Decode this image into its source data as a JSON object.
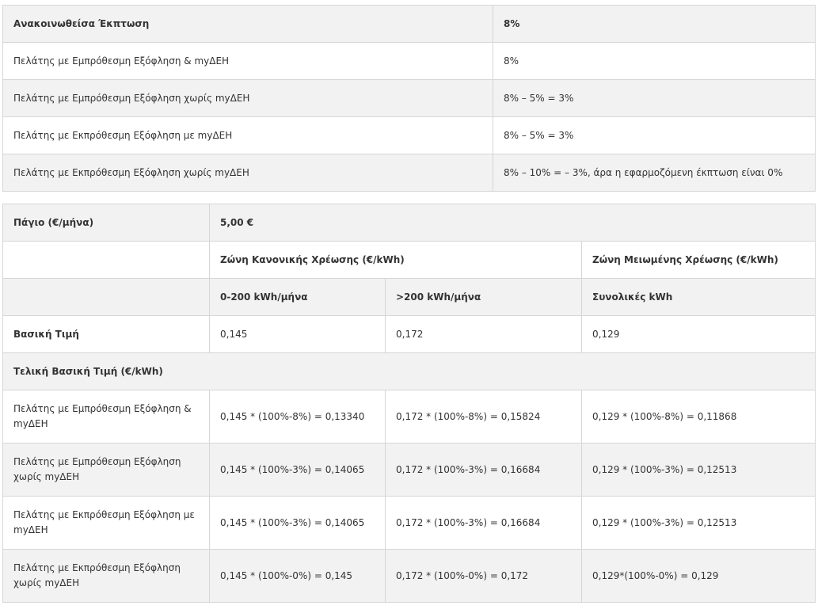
{
  "discount_table": {
    "header": {
      "label": "Ανακοινωθείσα Έκπτωση",
      "value": "8%"
    },
    "rows": [
      {
        "label": "Πελάτης με Εμπρόθεσμη Εξόφληση & myΔΕΗ",
        "value": "8%"
      },
      {
        "label": "Πελάτης με Εμπρόθεσμη Εξόφληση χωρίς myΔΕΗ",
        "value": "8% – 5% = 3%"
      },
      {
        "label": "Πελάτης με Εκπρόθεσμη Εξόφληση με myΔΕΗ",
        "value": "8% – 5% = 3%"
      },
      {
        "label": "Πελάτης με Εκπρόθεσμη Εξόφληση χωρίς myΔΕΗ",
        "value": "8% – 10% = – 3%, άρα η εφαρμοζόμενη έκπτωση  είναι 0%"
      }
    ]
  },
  "price_table": {
    "fixed_charge_label": "Πάγιο (€/μήνα)",
    "fixed_charge_value": "5,00 €",
    "zone_normal": "Ζώνη Κανονικής Χρέωσης (€/kWh)",
    "zone_reduced": "Ζώνη Μειωμένης Χρέωσης (€/kWh)",
    "sub_headers": [
      "0-200 kWh/μήνα",
      ">200 kWh/μήνα",
      "Συνολικές kWh"
    ],
    "base_price": {
      "label": "Βασική Τιμή",
      "values": [
        "0,145",
        "0,172",
        "0,129"
      ]
    },
    "final_section_label": "Τελική Βασική Τιμή (€/kWh)",
    "final_rows": [
      {
        "label": "Πελάτης με Εμπρόθεσμη Εξόφληση & myΔΕΗ",
        "values": [
          "0,145 * (100%-8%) = 0,13340",
          "0,172 * (100%-8%) = 0,15824",
          "0,129 * (100%-8%) = 0,11868"
        ]
      },
      {
        "label": "Πελάτης με Εμπρόθεσμη Εξόφληση χωρίς myΔΕΗ",
        "values": [
          "0,145 * (100%-3%) = 0,14065",
          "0,172 * (100%-3%) = 0,16684",
          "0,129 * (100%-3%) = 0,12513"
        ]
      },
      {
        "label": "Πελάτης με Εκπρόθεσμη Εξόφληση με myΔΕΗ",
        "values": [
          "0,145 * (100%-3%) = 0,14065",
          "0,172 * (100%-3%) = 0,16684",
          "0,129 * (100%-3%) = 0,12513"
        ]
      },
      {
        "label": "Πελάτης με Εκπρόθεσμη Εξόφληση χωρίς myΔΕΗ",
        "values": [
          "0,145 * (100%-0%) = 0,145",
          "0,172 * (100%-0%) = 0,172",
          "0,129*(100%-0%) = 0,129"
        ]
      }
    ]
  }
}
